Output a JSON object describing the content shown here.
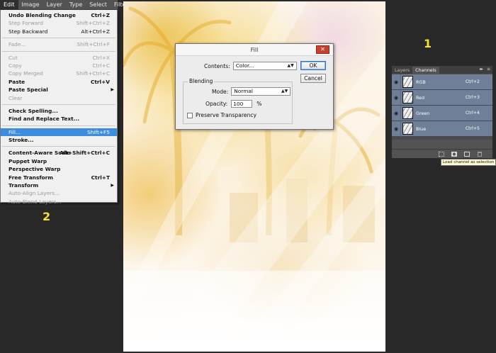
{
  "menubar": {
    "items": [
      {
        "label": "Edit",
        "active": true
      },
      {
        "label": "Image"
      },
      {
        "label": "Layer"
      },
      {
        "label": "Type"
      },
      {
        "label": "Select"
      },
      {
        "label": "Filter"
      }
    ]
  },
  "edit_menu": {
    "items": [
      {
        "label": "Undo Blending Change",
        "shortcut": "Ctrl+Z"
      },
      {
        "label": "Step Forward",
        "shortcut": "Shift+Ctrl+Z"
      },
      {
        "label": "Step Backward",
        "shortcut": "Alt+Ctrl+Z"
      },
      {
        "label": "Fade...",
        "shortcut": "Shift+Ctrl+F"
      },
      {
        "label": "Cut",
        "shortcut": "Ctrl+X"
      },
      {
        "label": "Copy",
        "shortcut": "Ctrl+C"
      },
      {
        "label": "Copy Merged",
        "shortcut": "Shift+Ctrl+C"
      },
      {
        "label": "Paste",
        "shortcut": "Ctrl+V"
      },
      {
        "label": "Paste Special",
        "shortcut": ""
      },
      {
        "label": "Clear",
        "shortcut": ""
      },
      {
        "label": "Check Spelling...",
        "shortcut": ""
      },
      {
        "label": "Find and Replace Text...",
        "shortcut": ""
      },
      {
        "label": "Fill...",
        "shortcut": "Shift+F5"
      },
      {
        "label": "Stroke...",
        "shortcut": ""
      },
      {
        "label": "Content-Aware Scale",
        "shortcut": "Alt+Shift+Ctrl+C"
      },
      {
        "label": "Puppet Warp",
        "shortcut": ""
      },
      {
        "label": "Perspective Warp",
        "shortcut": ""
      },
      {
        "label": "Free Transform",
        "shortcut": "Ctrl+T"
      },
      {
        "label": "Transform",
        "shortcut": ""
      },
      {
        "label": "Auto-Align Layers...",
        "shortcut": ""
      },
      {
        "label": "Auto-Blend Layers...",
        "shortcut": ""
      }
    ]
  },
  "fill_dialog": {
    "title": "Fill",
    "close_label": "✕",
    "contents_label": "Contents:",
    "contents_value": "Color...",
    "ok_label": "OK",
    "cancel_label": "Cancel",
    "blending_label": "Blending",
    "mode_label": "Mode:",
    "mode_value": "Normal",
    "opacity_label": "Opacity:",
    "opacity_value": "100",
    "opacity_unit": "%",
    "preserve_label": "Preserve Transparency"
  },
  "channels_panel": {
    "tab_layers": "Layers",
    "tab_channels": "Channels",
    "menu_collapse": "▸▸",
    "menu_options": "≡",
    "channels": [
      {
        "name": "RGB",
        "shortcut": "Ctrl+2"
      },
      {
        "name": "Red",
        "shortcut": "Ctrl+3"
      },
      {
        "name": "Green",
        "shortcut": "Ctrl+4"
      },
      {
        "name": "Blue",
        "shortcut": "Ctrl+5"
      }
    ],
    "tooltip": "Load channel as selection"
  },
  "annotations": {
    "one": "1",
    "two": "2"
  },
  "colors": {
    "background": "#282828",
    "menu_highlight": "#3c8de0",
    "channel_row": "#6f7f98",
    "close_button": "#c8402f",
    "annotation": "#f6e22a"
  },
  "icons": {
    "eye": "eye-icon",
    "submenu_arrow": "chevron-right-icon",
    "dropdown": "chevron-down-icon"
  }
}
